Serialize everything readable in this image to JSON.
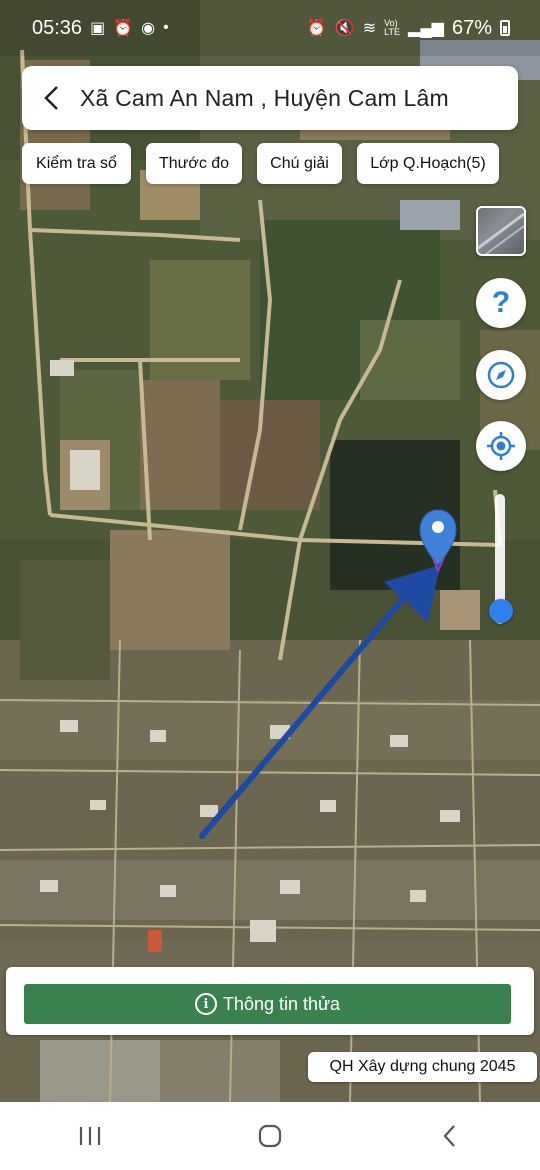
{
  "status_bar": {
    "time": "05:36",
    "battery": "67%",
    "left_icons": [
      "image-icon",
      "alarm-icon",
      "messenger-icon",
      "dot-icon"
    ],
    "right_icons": [
      "alarm-icon",
      "mute-icon",
      "wifi-icon",
      "volte-icon",
      "signal-icon",
      "battery-icon"
    ]
  },
  "search": {
    "title": "Xã Cam An Nam , Huyện Cam Lâm"
  },
  "chips": [
    {
      "label": "Kiểm tra sổ"
    },
    {
      "label": "Thước đo"
    },
    {
      "label": "Chú giải"
    },
    {
      "label": "Lớp Q.Hoạch(5)"
    }
  ],
  "map_controls": {
    "layer": "map-layer-icon",
    "help": "?",
    "compass": "compass-icon",
    "location": "my-location-icon",
    "zoom_level": 0.1
  },
  "info_panel": {
    "button_label": "Thông tin thửa",
    "icon": "i"
  },
  "plan_label": "QH Xây dựng chung 2045",
  "colors": {
    "primary_green": "#3a8150",
    "marker_blue": "#3d82d8",
    "arrow_blue": "#1f4aa3",
    "slider_blue": "#2f80ed"
  }
}
